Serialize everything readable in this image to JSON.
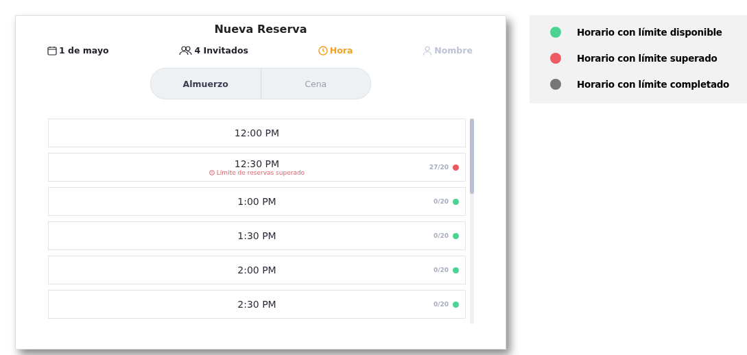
{
  "dialog": {
    "title": "Nueva Reserva"
  },
  "steps": [
    {
      "kind": "date",
      "label": "1 de mayo",
      "done": true,
      "selected": false
    },
    {
      "kind": "guests",
      "label": "4 Invitados",
      "done": true,
      "selected": false
    },
    {
      "kind": "time",
      "label": "Hora",
      "done": false,
      "selected": true
    },
    {
      "kind": "name",
      "label": "Nombre",
      "done": false,
      "selected": false
    }
  ],
  "meal_tabs": [
    {
      "label": "Almuerzo",
      "selected": true
    },
    {
      "label": "Cena",
      "selected": false
    }
  ],
  "slots": [
    {
      "time": "12:00 PM"
    },
    {
      "time": "12:30 PM",
      "count": "27/20",
      "color": "#ea5a5f",
      "warning": "Límite de reservas superado"
    },
    {
      "time": "1:00 PM",
      "count": "0/20",
      "color": "#4cd293"
    },
    {
      "time": "1:30 PM",
      "count": "0/20",
      "color": "#4cd293"
    },
    {
      "time": "2:00 PM",
      "count": "0/20",
      "color": "#4cd293"
    },
    {
      "time": "2:30 PM",
      "count": "0/20",
      "color": "#4cd293"
    }
  ],
  "legend": [
    {
      "label": "Horario con límite disponible",
      "color": "#4cd293"
    },
    {
      "label": "Horario con límite superado",
      "color": "#ef5a63"
    },
    {
      "label": "Horario con límite completado",
      "color": "#767676"
    }
  ]
}
